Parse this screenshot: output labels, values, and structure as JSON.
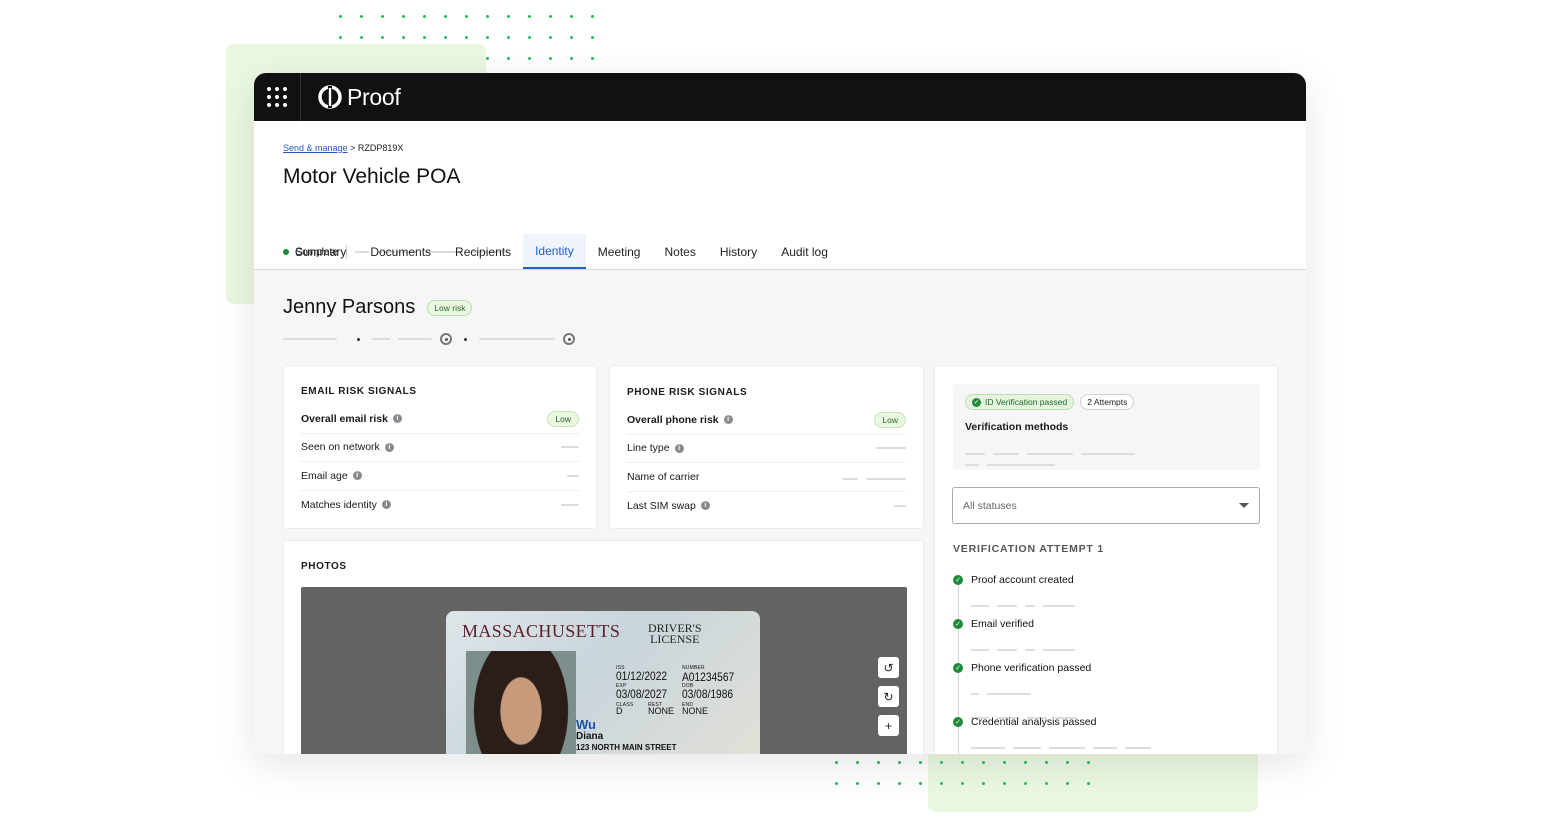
{
  "app": {
    "brand": "Proof"
  },
  "breadcrumb": {
    "link": "Send & manage",
    "separator": ">",
    "current": "RZDP819X"
  },
  "transaction": {
    "title": "Motor Vehicle POA",
    "status": "Complete"
  },
  "tabs": [
    {
      "label": "Summary"
    },
    {
      "label": "Documents"
    },
    {
      "label": "Recipients"
    },
    {
      "label": "Identity",
      "active": true
    },
    {
      "label": "Meeting"
    },
    {
      "label": "Notes"
    },
    {
      "label": "History"
    },
    {
      "label": "Audit log"
    }
  ],
  "signer": {
    "name": "Jenny Parsons",
    "risk_badge": "Low risk"
  },
  "email_risk": {
    "title": "EMAIL RISK SIGNALS",
    "overall_label": "Overall email risk",
    "overall_value": "Low",
    "rows": [
      {
        "label": "Seen on network"
      },
      {
        "label": "Email age"
      },
      {
        "label": "Matches identity"
      }
    ]
  },
  "phone_risk": {
    "title": "PHONE RISK SIGNALS",
    "overall_label": "Overall phone risk",
    "overall_value": "Low",
    "rows": [
      {
        "label": "Line type"
      },
      {
        "label": "Name of carrier"
      },
      {
        "label": "Last SIM swap"
      }
    ]
  },
  "photos": {
    "title": "PHOTOS",
    "id_card": {
      "state": "MASSACHUSETTS",
      "type_line1": "DRIVER'S",
      "type_line2": "LICENSE",
      "iss_label": "ISS",
      "iss": "01/12/2022",
      "exp_label": "EXP",
      "exp": "03/08/2027",
      "number_label": "NUMBER",
      "number": "A01234567",
      "dob_label": "DOB",
      "dob": "03/08/1986",
      "class_label": "CLASS",
      "class": "D",
      "rest_label": "REST",
      "rest": "NONE",
      "end_label": "END",
      "end": "NONE",
      "last_name": "Wu",
      "first_name": "Diana",
      "address": "123 NORTH MAIN STREET"
    }
  },
  "verification": {
    "badge_passed": "ID Verification passed",
    "badge_attempts": "2 Attempts",
    "methods_label": "Verification methods",
    "filter_value": "All statuses",
    "attempt_title": "VERIFICATION ATTEMPT 1",
    "steps": [
      {
        "label": "Proof account created"
      },
      {
        "label": "Email verified"
      },
      {
        "label": "Phone verification passed"
      },
      {
        "label": "Credential analysis passed"
      }
    ]
  },
  "colors": {
    "accent": "#1f5fd1",
    "success": "#1e8a3a",
    "topbar": "#111111",
    "low_badge_bg": "#eaf7e1"
  }
}
